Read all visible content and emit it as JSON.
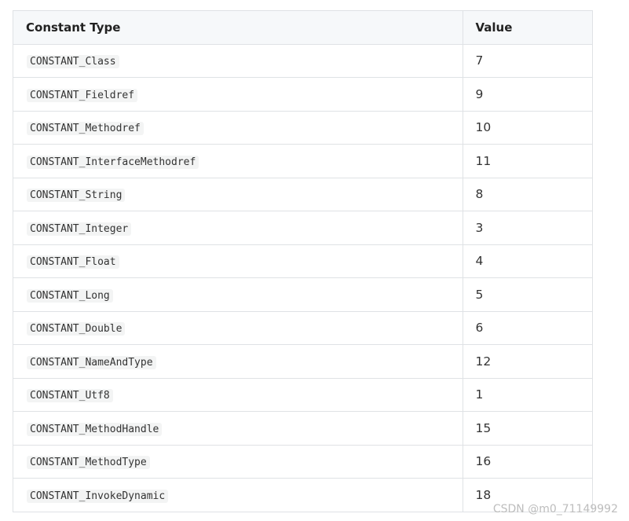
{
  "table": {
    "headers": {
      "type": "Constant Type",
      "value": "Value"
    },
    "rows": [
      {
        "type": "CONSTANT_Class",
        "value": "7"
      },
      {
        "type": "CONSTANT_Fieldref",
        "value": "9"
      },
      {
        "type": "CONSTANT_Methodref",
        "value": "10"
      },
      {
        "type": "CONSTANT_InterfaceMethodref",
        "value": "11"
      },
      {
        "type": "CONSTANT_String",
        "value": "8"
      },
      {
        "type": "CONSTANT_Integer",
        "value": "3"
      },
      {
        "type": "CONSTANT_Float",
        "value": "4"
      },
      {
        "type": "CONSTANT_Long",
        "value": "5"
      },
      {
        "type": "CONSTANT_Double",
        "value": "6"
      },
      {
        "type": "CONSTANT_NameAndType",
        "value": "12"
      },
      {
        "type": "CONSTANT_Utf8",
        "value": "1"
      },
      {
        "type": "CONSTANT_MethodHandle",
        "value": "15"
      },
      {
        "type": "CONSTANT_MethodType",
        "value": "16"
      },
      {
        "type": "CONSTANT_InvokeDynamic",
        "value": "18"
      }
    ]
  },
  "watermark": "CSDN @m0_71149992"
}
